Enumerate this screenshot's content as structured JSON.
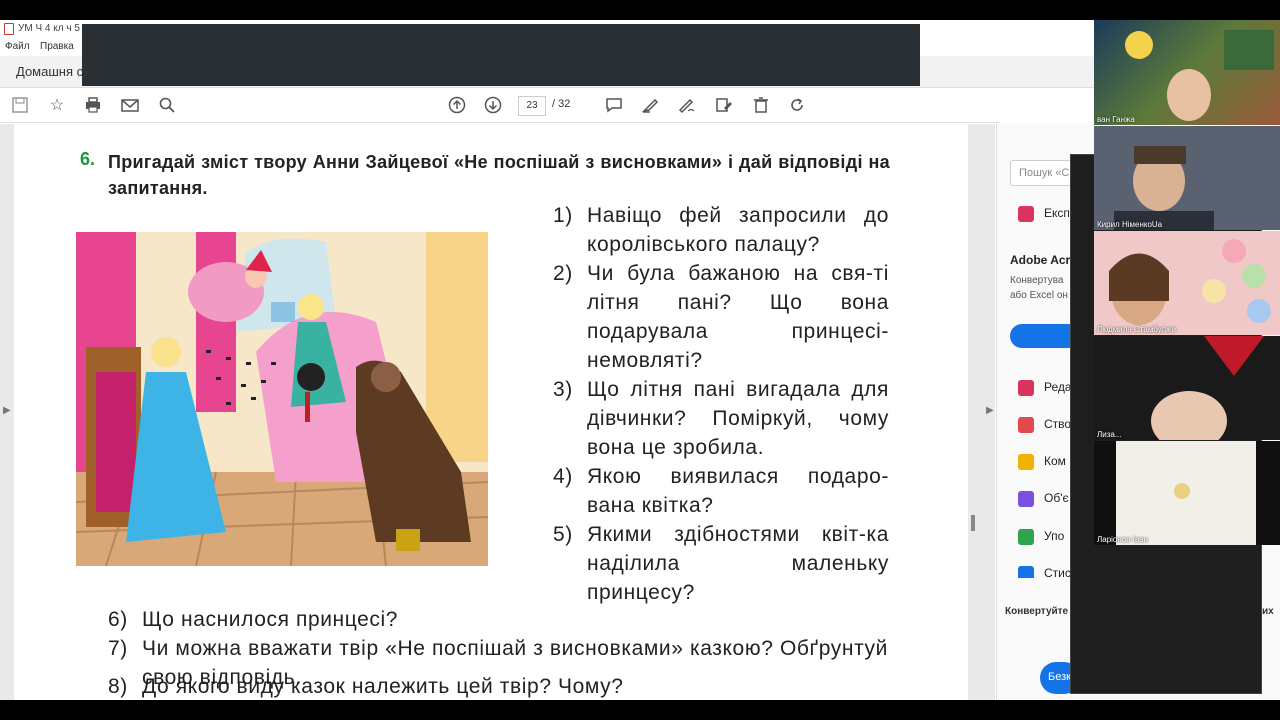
{
  "window": {
    "doc_title": "УМ Ч 4 кл ч 5",
    "menu": [
      "Файл",
      "Правка"
    ],
    "home_tab": "Домашня с"
  },
  "toolbar": {
    "page_current": "23",
    "page_total": "/ 32",
    "icons": [
      "save-icon",
      "star-icon",
      "print-icon",
      "email-icon",
      "search-icon",
      "page-up-icon",
      "page-down-icon",
      "comment-icon",
      "highlight-icon",
      "sign-icon",
      "edit-icon",
      "delete-icon",
      "rotate-icon"
    ]
  },
  "document": {
    "task_number": "6.",
    "task_text": "Пригадай зміст твору Анни Зайцевої «Не поспішай з висновками» і дай відповіді на запитання.",
    "questions": [
      {
        "n": "1)",
        "text": "Навіщо фей запросили до королівського палацу?"
      },
      {
        "n": "2)",
        "text": "Чи була бажаною на свя-ті літня пані? Що вона подарувала принцесі-немовляті?"
      },
      {
        "n": "3)",
        "text": "Що літня пані вигадала для дівчинки? Поміркуй, чому вона це зробила."
      },
      {
        "n": "4)",
        "text": "Якою виявилася подаро-вана квітка?"
      },
      {
        "n": "5)",
        "text": "Якими здібностями квіт-ка наділила маленьку принцесу?"
      },
      {
        "n": "6)",
        "text": "Що наснилося принцесі?"
      },
      {
        "n": "7)",
        "text": "Чи можна вважати твір «Не поспішай з висновками» казкою? Обґрунтуй свою відповідь."
      },
      {
        "n": "8)",
        "text": "До якого виду казок належить цей твір? Чому?"
      }
    ]
  },
  "right_panel": {
    "search_placeholder": "Пошук «С",
    "export_label": "Експ",
    "promo_title": "Adobe Acro",
    "promo_line1": "Конвертува",
    "promo_line2": "або Excel он",
    "tools": [
      {
        "label": "Реда",
        "color": "#d9345b"
      },
      {
        "label": "Ство",
        "color": "#e34850"
      },
      {
        "label": "Ком",
        "color": "#f0b100"
      },
      {
        "label": "Об'є",
        "color": "#7b4fe0"
      },
      {
        "label": "Упо",
        "color": "#2da44e"
      },
      {
        "label": "Стис",
        "color": "#1473e6"
      }
    ],
    "convert_label": "Конвертуйте",
    "convert_label_end": "их",
    "button_label": "Безк"
  },
  "participants": [
    {
      "name": "ван Ганжа"
    },
    {
      "name": "Кирил НіменкоUa"
    },
    {
      "name": "Людмила Стамбулжи"
    },
    {
      "name": "Лиза..."
    },
    {
      "name": "Ларіонов Іван"
    }
  ]
}
